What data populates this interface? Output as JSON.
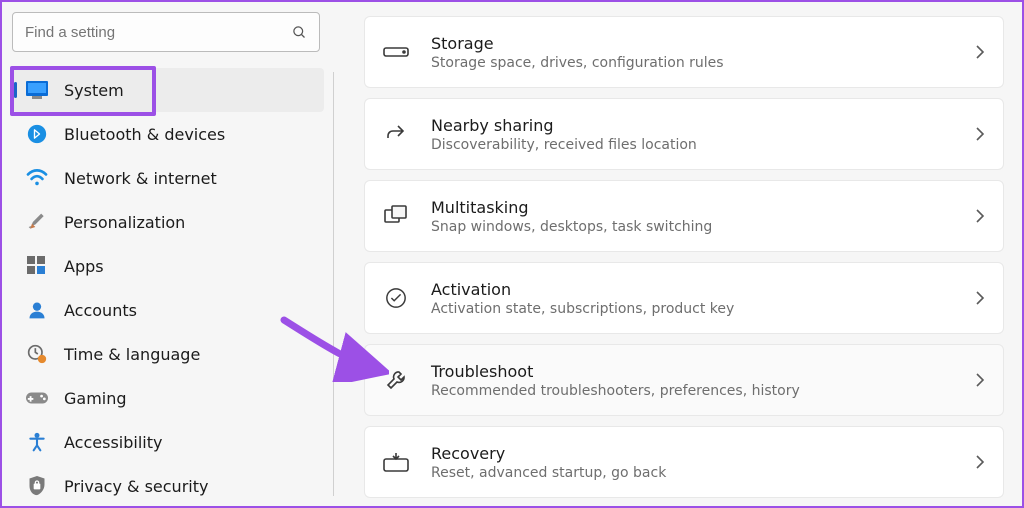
{
  "search": {
    "placeholder": "Find a setting"
  },
  "sidebar": {
    "items": [
      {
        "label": "System"
      },
      {
        "label": "Bluetooth & devices"
      },
      {
        "label": "Network & internet"
      },
      {
        "label": "Personalization"
      },
      {
        "label": "Apps"
      },
      {
        "label": "Accounts"
      },
      {
        "label": "Time & language"
      },
      {
        "label": "Gaming"
      },
      {
        "label": "Accessibility"
      },
      {
        "label": "Privacy & security"
      }
    ]
  },
  "cards": [
    {
      "title": "Storage",
      "sub": "Storage space, drives, configuration rules"
    },
    {
      "title": "Nearby sharing",
      "sub": "Discoverability, received files location"
    },
    {
      "title": "Multitasking",
      "sub": "Snap windows, desktops, task switching"
    },
    {
      "title": "Activation",
      "sub": "Activation state, subscriptions, product key"
    },
    {
      "title": "Troubleshoot",
      "sub": "Recommended troubleshooters, preferences, history"
    },
    {
      "title": "Recovery",
      "sub": "Reset, advanced startup, go back"
    }
  ]
}
